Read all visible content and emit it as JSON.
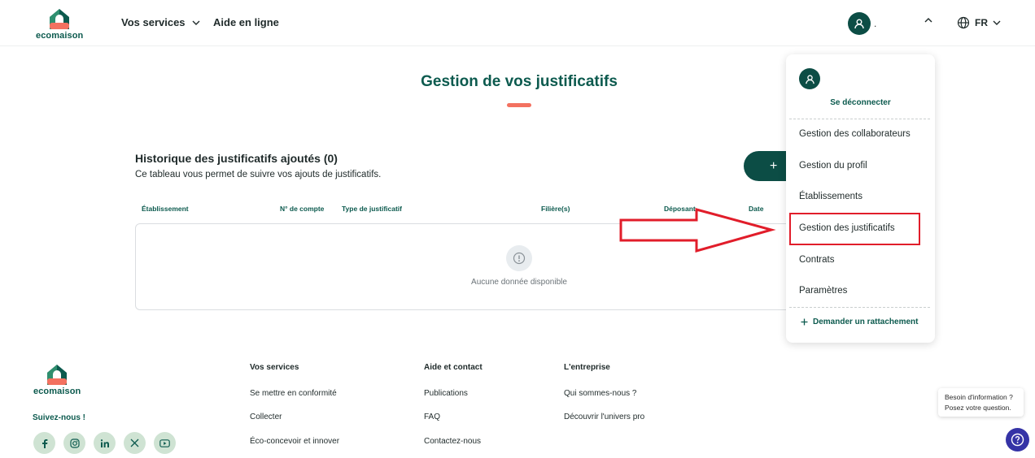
{
  "header": {
    "logo_text": "ecomaison",
    "nav_services": "Vos services",
    "nav_help": "Aide en ligne",
    "user_name": ".",
    "lang": "FR"
  },
  "main": {
    "title": "Gestion de vos justificatifs",
    "section_title": "Historique des justificatifs ajoutés (0)",
    "section_subtitle": "Ce tableau vous permet de suivre vos ajouts de justificatifs.",
    "add_button": "+",
    "columns": [
      "Établissement",
      "N° de compte",
      "Type de justificatif",
      "Filière(s)",
      "Déposant",
      "Date"
    ],
    "empty_text": "Aucune donnée disponible"
  },
  "dropdown": {
    "logout": "Se déconnecter",
    "items": [
      "Gestion des collaborateurs",
      "Gestion du profil",
      "Établissements",
      "Gestion des justificatifs",
      "Contrats",
      "Paramètres"
    ],
    "attach": "Demander un rattachement"
  },
  "footer": {
    "logo_text": "ecomaison",
    "follow": "Suivez-nous !",
    "socials": [
      "facebook-icon",
      "instagram-icon",
      "linkedin-icon",
      "x-icon",
      "youtube-icon"
    ],
    "services": {
      "heading": "Vos services",
      "links": [
        "Se mettre en conformité",
        "Collecter",
        "Éco-concevoir et innover"
      ]
    },
    "help": {
      "heading": "Aide et contact",
      "links": [
        "Publications",
        "FAQ",
        "Contactez-nous"
      ]
    },
    "company": {
      "heading": "L'entreprise",
      "links": [
        "Qui sommes-nous ?",
        "Découvrir l'univers pro"
      ]
    }
  },
  "help_widget": {
    "line1": "Besoin d'information ?",
    "line2": "Posez votre question."
  },
  "colors": {
    "brand_green": "#0c4d45",
    "accent_coral": "#f37160",
    "annotation_red": "#e11d2a",
    "help_purple": "#3533a6"
  }
}
